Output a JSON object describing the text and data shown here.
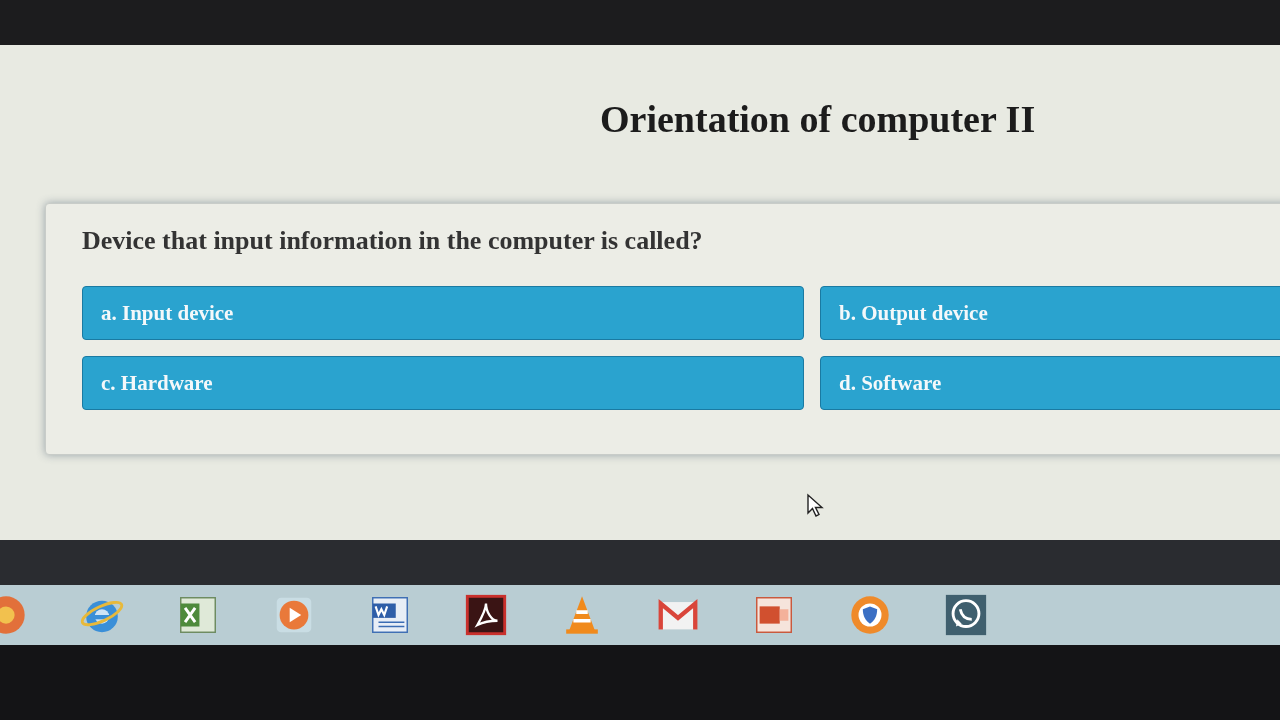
{
  "page": {
    "title": "Orientation of computer II"
  },
  "quiz": {
    "question": "Device that input information in the computer is called?",
    "options": [
      {
        "label": "a. Input device"
      },
      {
        "label": "b. Output device"
      },
      {
        "label": "c. Hardware"
      },
      {
        "label": "d. Software"
      }
    ]
  },
  "taskbar": {
    "apps": [
      {
        "kind": "ball"
      },
      {
        "kind": "ie"
      },
      {
        "kind": "sheet"
      },
      {
        "kind": "play"
      },
      {
        "kind": "doc"
      },
      {
        "kind": "pdf"
      },
      {
        "kind": "cone"
      },
      {
        "kind": "mail"
      },
      {
        "kind": "slides"
      },
      {
        "kind": "shield"
      },
      {
        "kind": "chat"
      }
    ]
  }
}
